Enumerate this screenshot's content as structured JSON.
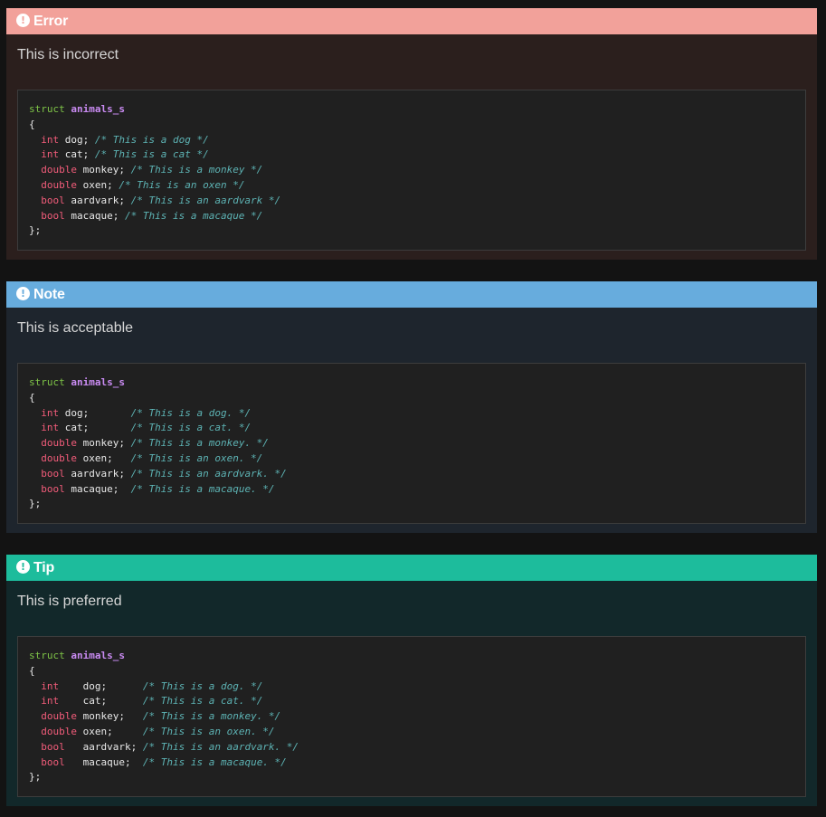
{
  "error": {
    "title": "Error",
    "text": "This is incorrect",
    "code": [
      {
        "struct": "struct",
        "name": "animals_s"
      },
      "{",
      {
        "type": "int",
        "field": " dog;",
        "comment": " /* This is a dog */"
      },
      {
        "type": "int",
        "field": " cat;",
        "comment": " /* This is a cat */"
      },
      {
        "type": "double",
        "field": " monkey;",
        "comment": " /* This is a monkey */"
      },
      {
        "type": "double",
        "field": " oxen;",
        "comment": " /* This is an oxen */"
      },
      {
        "type": "bool",
        "field": " aardvark;",
        "comment": " /* This is an aardvark */"
      },
      {
        "type": "bool",
        "field": " macaque;",
        "comment": " /* This is a macaque */"
      },
      "};"
    ]
  },
  "note": {
    "title": "Note",
    "text": "This is acceptable",
    "code": [
      {
        "struct": "struct",
        "name": "animals_s"
      },
      "{",
      {
        "type": "int",
        "field": " dog;       ",
        "comment": "/* This is a dog. */"
      },
      {
        "type": "int",
        "field": " cat;       ",
        "comment": "/* This is a cat. */"
      },
      {
        "type": "double",
        "field": " monkey; ",
        "comment": "/* This is a monkey. */"
      },
      {
        "type": "double",
        "field": " oxen;   ",
        "comment": "/* This is an oxen. */"
      },
      {
        "type": "bool",
        "field": " aardvark; ",
        "comment": "/* This is an aardvark. */"
      },
      {
        "type": "bool",
        "field": " macaque;  ",
        "comment": "/* This is a macaque. */"
      },
      "};"
    ]
  },
  "tip": {
    "title": "Tip",
    "text": "This is preferred",
    "code": [
      {
        "struct": "struct",
        "name": "animals_s"
      },
      "{",
      {
        "type": "int   ",
        "field": " dog;      ",
        "comment": "/* This is a dog. */"
      },
      {
        "type": "int   ",
        "field": " cat;      ",
        "comment": "/* This is a cat. */"
      },
      {
        "type": "double",
        "field": " monkey;   ",
        "comment": "/* This is a monkey. */"
      },
      {
        "type": "double",
        "field": " oxen;     ",
        "comment": "/* This is an oxen. */"
      },
      {
        "type": "bool  ",
        "field": " aardvark; ",
        "comment": "/* This is an aardvark. */"
      },
      {
        "type": "bool  ",
        "field": " macaque;  ",
        "comment": "/* This is a macaque. */"
      },
      "};"
    ]
  },
  "colors": {
    "error_header": "#f2a19a",
    "note_header": "#67acdd",
    "tip_header": "#1dbc9c",
    "keyword_struct": "#7ec447",
    "struct_name": "#c98bf2",
    "type": "#f25c7a",
    "comment": "#5db3b4"
  },
  "icons": {
    "header_icon": "exclamation-circle-icon"
  }
}
